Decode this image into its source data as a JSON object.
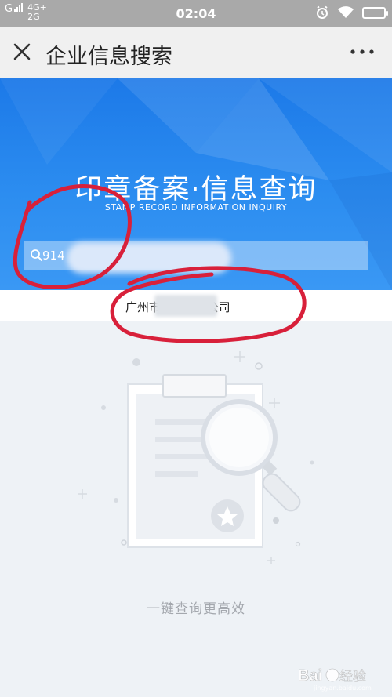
{
  "status_bar": {
    "carrier1": "G",
    "net_top": "4G+",
    "net_bottom": "2G",
    "time": "02:04",
    "icons": [
      "alarm-icon",
      "wifi-icon",
      "battery-icon"
    ]
  },
  "title_bar": {
    "title": "企业信息搜索",
    "close_icon": "close-icon",
    "more_icon": "more-dots-icon"
  },
  "hero": {
    "title": "印章备案·信息查询",
    "subtitle": "STAMP RECORD INFORMATION INQUIRY",
    "search_value": "914"
  },
  "result": {
    "company_name": "广州市      有限公司"
  },
  "empty_state": {
    "text": "一键查询更高效"
  },
  "watermark": {
    "text": "Baidu 经验",
    "url": "jingyan.baidu.com"
  },
  "colors": {
    "accent_blue": "#1c79e8",
    "annotation_red": "#d8203a",
    "empty_text": "#a4a8ae"
  }
}
